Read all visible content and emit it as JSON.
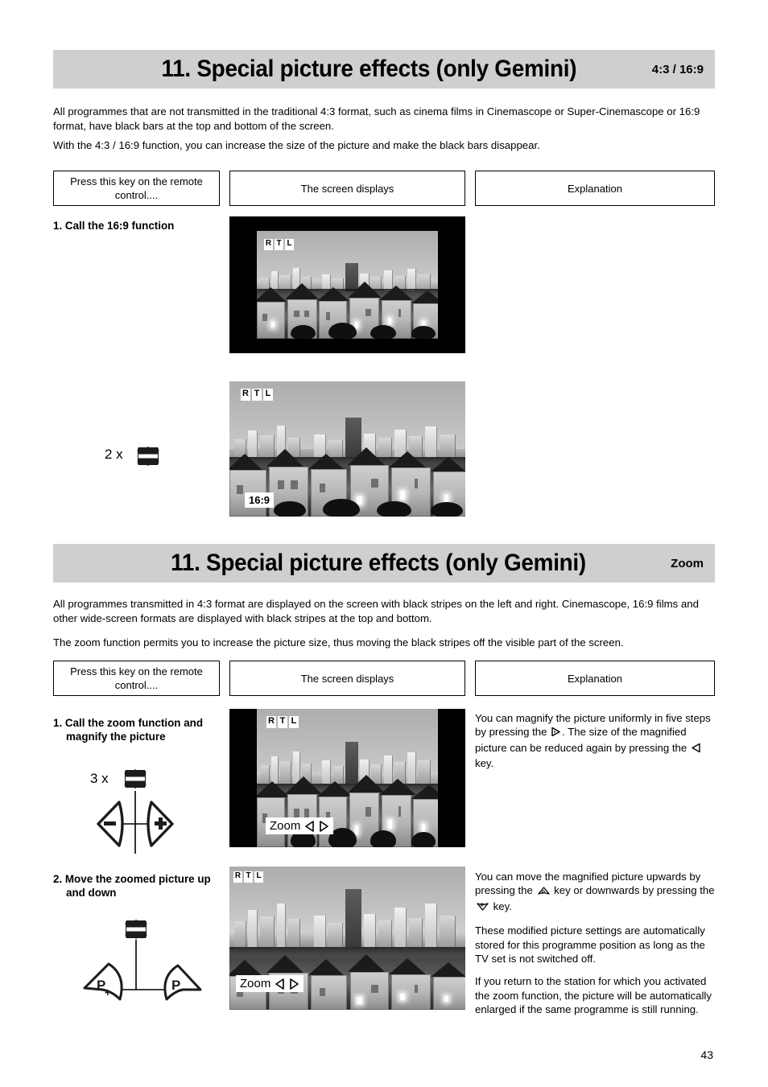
{
  "page_number": "43",
  "sections": [
    {
      "id": "aspect",
      "title_main": "11. Special picture effects",
      "title_sub": "(only Gemini)",
      "tag": "4:3 / 16:9",
      "paragraphs": [
        "All programmes that are not transmitted in the traditional 4:3 format, such as cinema films in Cinemascope or Super-Cinemascope or 16:9 format, have black bars at the top and bottom of the screen.",
        "With the 4:3 / 16:9 function, you can increase the size of the picture and make the black bars disappear."
      ],
      "columns": [
        "Press this key on the remote control....",
        "The screen displays",
        "Explanation"
      ],
      "steps": [
        {
          "number": "1.",
          "line1": "Call the 16:9 function",
          "line2": ""
        }
      ],
      "key_press": {
        "count": "2 x",
        "key": "format-key"
      },
      "screens": [
        {
          "id": "screen-43-letterbox",
          "logo": [
            "R",
            "T",
            "L"
          ],
          "osd": ""
        },
        {
          "id": "screen-169-full",
          "logo": [
            "R",
            "T",
            "L"
          ],
          "osd": "16:9"
        }
      ]
    },
    {
      "id": "zoom",
      "title_main": "11. Special picture effects",
      "title_sub": "(only Gemini)",
      "tag": "Zoom",
      "paragraphs": [
        "All programmes transmitted in 4:3 format are displayed on the screen with black stripes on the left and right. Cinemascope, 16:9 films and other wide-screen formats are displayed with black stripes at the top and bottom.",
        "The zoom function permits you to increase the picture size, thus moving the black stripes off the visible part of the screen."
      ],
      "columns": [
        "Press this key on the remote control....",
        "The screen displays",
        "Explanation"
      ],
      "steps": [
        {
          "number": "1.",
          "line1": "Call the zoom function and",
          "line2": "magnify the picture"
        },
        {
          "number": "2.",
          "line1": "Move the zoomed picture up",
          "line2": "and down"
        }
      ],
      "key_press": {
        "count": "3 x",
        "key": "format-key"
      },
      "keys": {
        "minus": "−",
        "plus": "+",
        "p_plus": "P+",
        "p_minus": "P-"
      },
      "screens": [
        {
          "id": "screen-zoom-pillarbox",
          "logo": [
            "R",
            "T",
            "L"
          ],
          "osd": "Zoom"
        },
        {
          "id": "screen-zoom-shifted",
          "logo": [
            "R",
            "T",
            "L"
          ],
          "osd": "Zoom"
        }
      ],
      "explanations": [
        {
          "id": "magnify",
          "parts": [
            {
              "t": "You can magnify the picture uniformly in five steps by pressing the "
            },
            {
              "icon": "right-arrow-key"
            },
            {
              "t": ". The size of the magnified picture can be reduced again by pressing the "
            },
            {
              "icon": "left-arrow-key"
            },
            {
              "t": " key."
            }
          ]
        },
        {
          "id": "move",
          "parts": [
            {
              "t": "You can move the magnified picture upwards by pressing the "
            },
            {
              "icon": "p-plus-key"
            },
            {
              "t": " key or downwards by pressing the "
            },
            {
              "icon": "p-minus-key"
            },
            {
              "t": " key."
            }
          ]
        },
        {
          "id": "stored",
          "parts": [
            {
              "t": "These modified picture settings are automatically stored for this programme position as long as the TV set is not switched off."
            }
          ]
        },
        {
          "id": "return",
          "parts": [
            {
              "t": "If you return to the station for which you activated the zoom function, the picture will be automatically enlarged if the same programme is still running."
            }
          ]
        }
      ]
    }
  ],
  "colors": {
    "header_bg": "#cfcfcf",
    "text": "#000000",
    "screen_bg": "#000000"
  }
}
